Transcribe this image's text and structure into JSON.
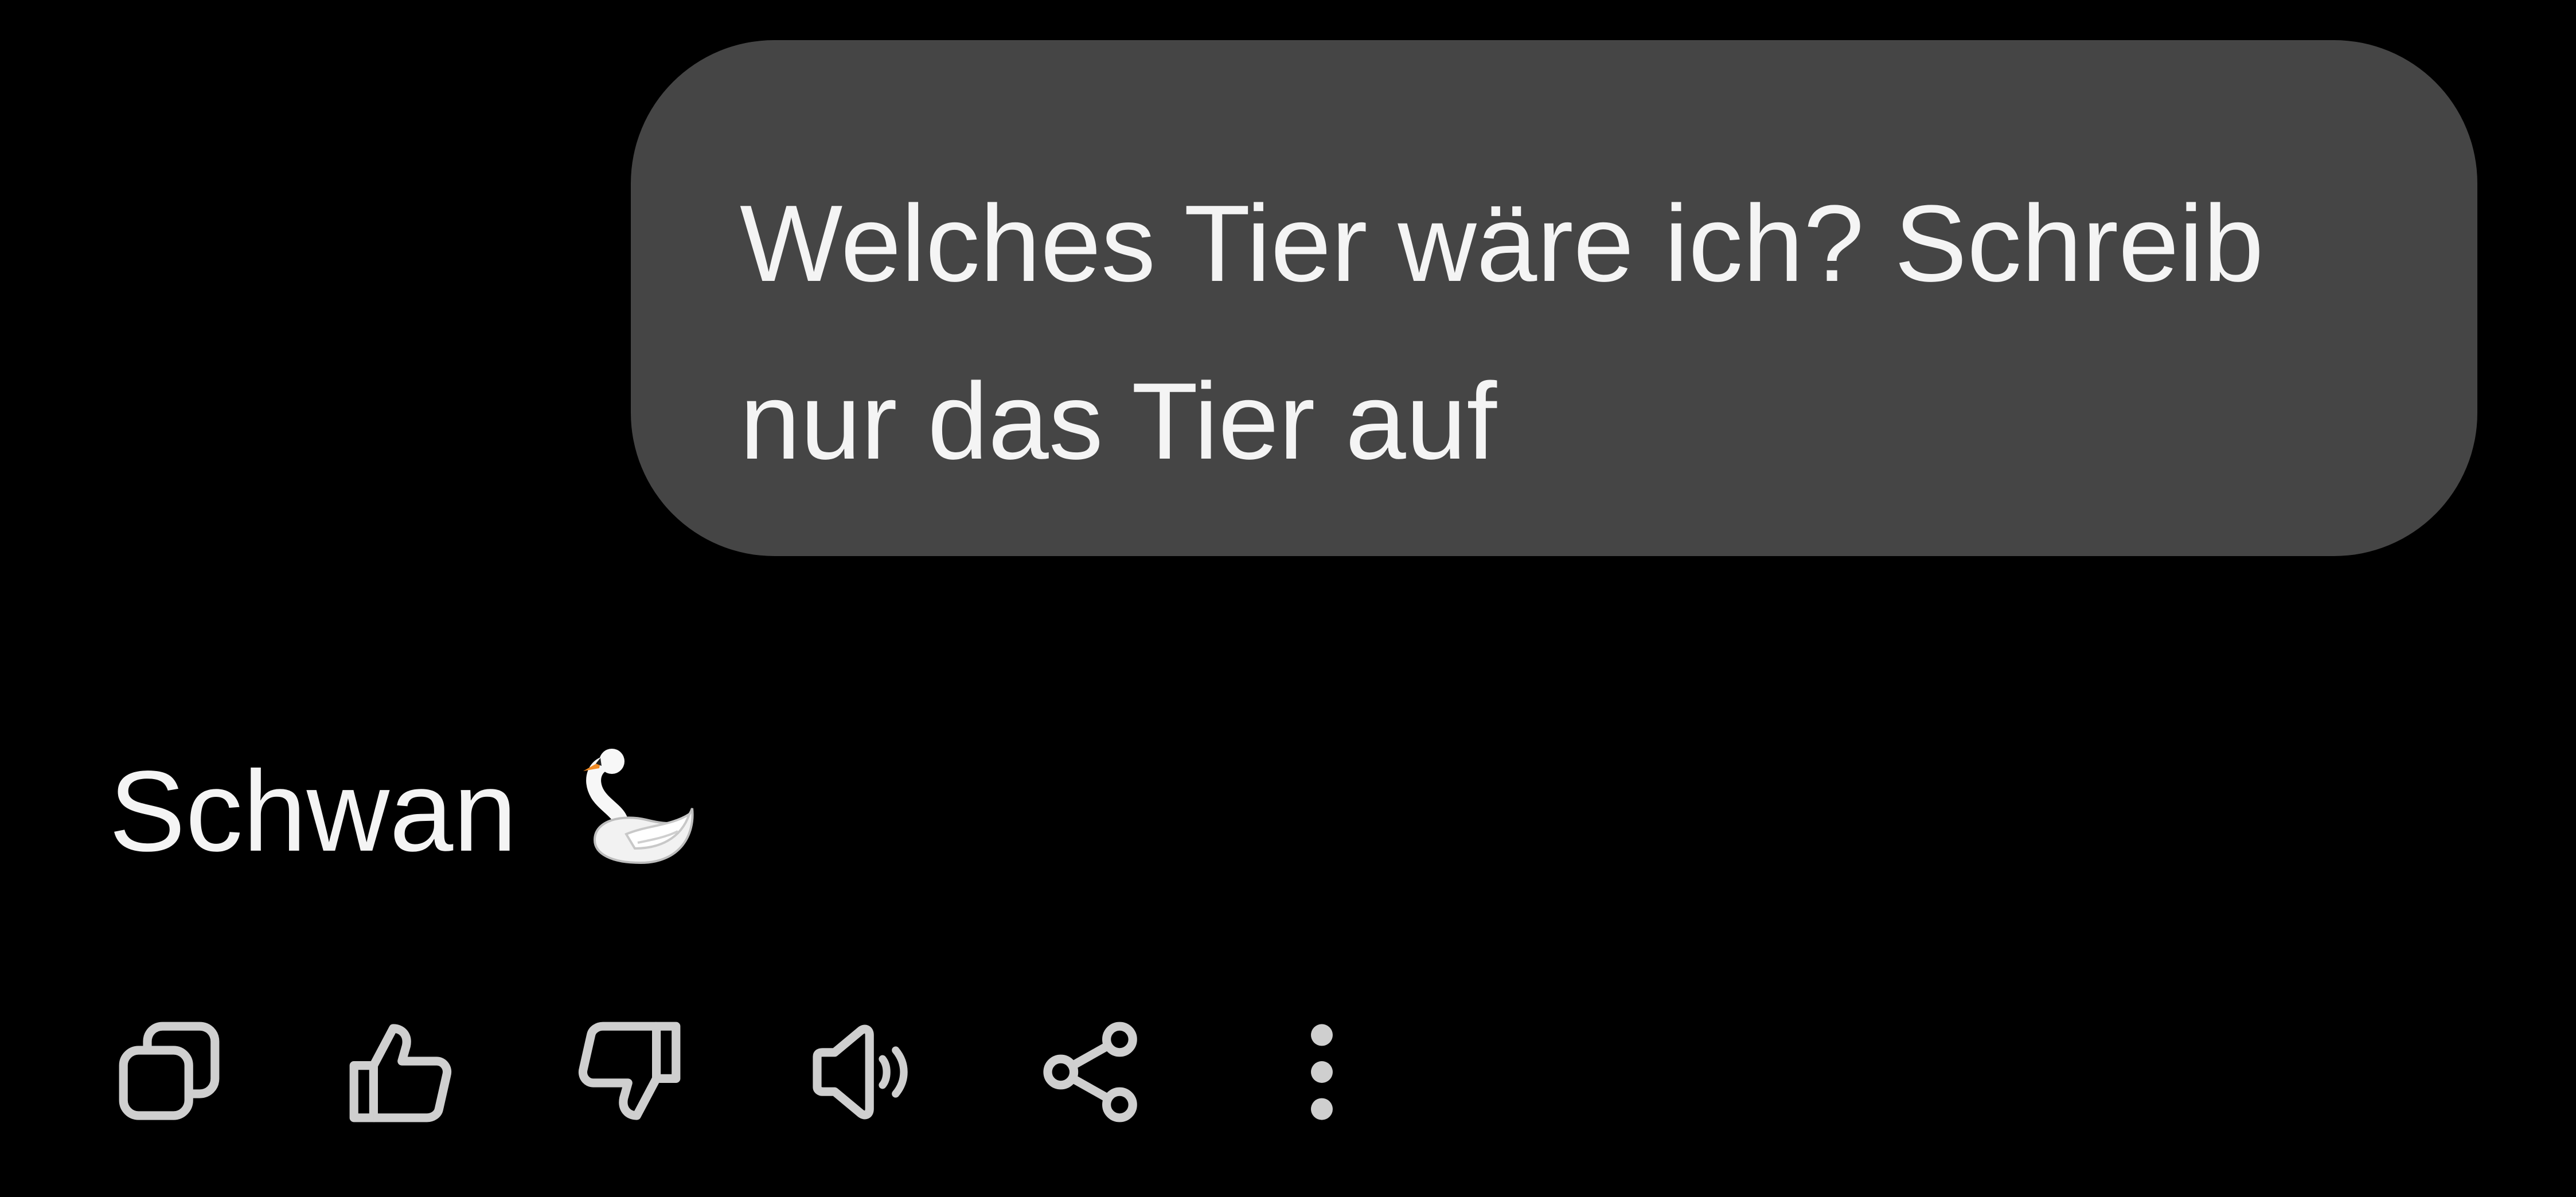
{
  "conversation": {
    "user_message": {
      "line1": "Welches Tier wäre ich? Schreib",
      "line2": "nur das Tier auf"
    },
    "assistant_message": {
      "text": "Schwan",
      "emoji_icon": "swan-icon"
    }
  },
  "actions": [
    {
      "icon": "copy-icon"
    },
    {
      "icon": "thumbs-up-icon"
    },
    {
      "icon": "thumbs-down-icon"
    },
    {
      "icon": "read-aloud-icon"
    },
    {
      "icon": "share-icon"
    },
    {
      "icon": "more-options-icon"
    }
  ],
  "colors": {
    "background": "#000000",
    "bubble": "#454545",
    "text": "#f4f4f4",
    "icon": "#cfcfcf"
  }
}
